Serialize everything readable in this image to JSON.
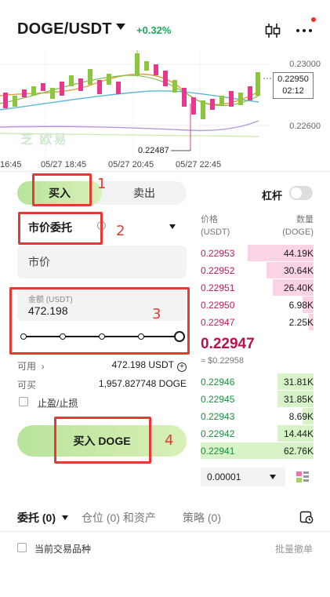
{
  "header": {
    "pair": "DOGE/USDT",
    "change": "+0.32%"
  },
  "chart": {
    "price_ticks": [
      "0.23000",
      "0.22600"
    ],
    "current_price": "0.22950",
    "countdown": "02:12",
    "low_label": "0.22487",
    "time_ticks": [
      "16:45",
      "05/27 18:45",
      "05/27 20:45",
      "05/27 22:45"
    ],
    "watermark": "芝 欧易"
  },
  "trade": {
    "buy_tab": "买入",
    "sell_tab": "卖出",
    "leverage_label": "杠杆",
    "order_type": "市价委托",
    "price_placeholder": "市价",
    "amount_label": "金额 (USDT)",
    "amount_value": "472.198",
    "available_label": "可用",
    "available_value": "472.198 USDT",
    "buyable_label": "可买",
    "buyable_value": "1,957.827748 DOGE",
    "tpsl_label": "止盈/止损",
    "buy_button": "买入 DOGE",
    "slider_percent": 100
  },
  "annotations": [
    "1",
    "2",
    "3",
    "4"
  ],
  "orderbook": {
    "price_header": "价格",
    "price_unit": "(USDT)",
    "qty_header": "数量",
    "qty_unit": "(DOGE)",
    "asks": [
      {
        "price": "0.22953",
        "qty": "44.19K",
        "depth": 0.58
      },
      {
        "price": "0.22952",
        "qty": "30.64K",
        "depth": 0.42
      },
      {
        "price": "0.22951",
        "qty": "26.40K",
        "depth": 0.36
      },
      {
        "price": "0.22950",
        "qty": "6.98K",
        "depth": 0.1
      },
      {
        "price": "0.22947",
        "qty": "2.25K",
        "depth": 0.04
      }
    ],
    "mid_price": "0.22947",
    "mid_fiat": "≈ $0.22958",
    "bids": [
      {
        "price": "0.22946",
        "qty": "31.81K",
        "depth": 0.32
      },
      {
        "price": "0.22945",
        "qty": "31.85K",
        "depth": 0.32
      },
      {
        "price": "0.22943",
        "qty": "8.69K",
        "depth": 0.1
      },
      {
        "price": "0.22942",
        "qty": "14.44K",
        "depth": 0.32
      },
      {
        "price": "0.22941",
        "qty": "62.76K",
        "depth": 1.0
      }
    ],
    "precision": "0.00001"
  },
  "bottom": {
    "tab_orders": "委托 (0)",
    "tab_positions": "仓位 (0) 和资产",
    "tab_strategy": "策略 (0)",
    "current_pair_label": "当前交易品种",
    "batch_cancel": "批量撤单"
  },
  "colors": {
    "up": "#1aa85a",
    "ask": "#c2185b",
    "bid": "#1b8e3d",
    "buy_accent": "#b8e39a",
    "annotation": "#e53935"
  }
}
